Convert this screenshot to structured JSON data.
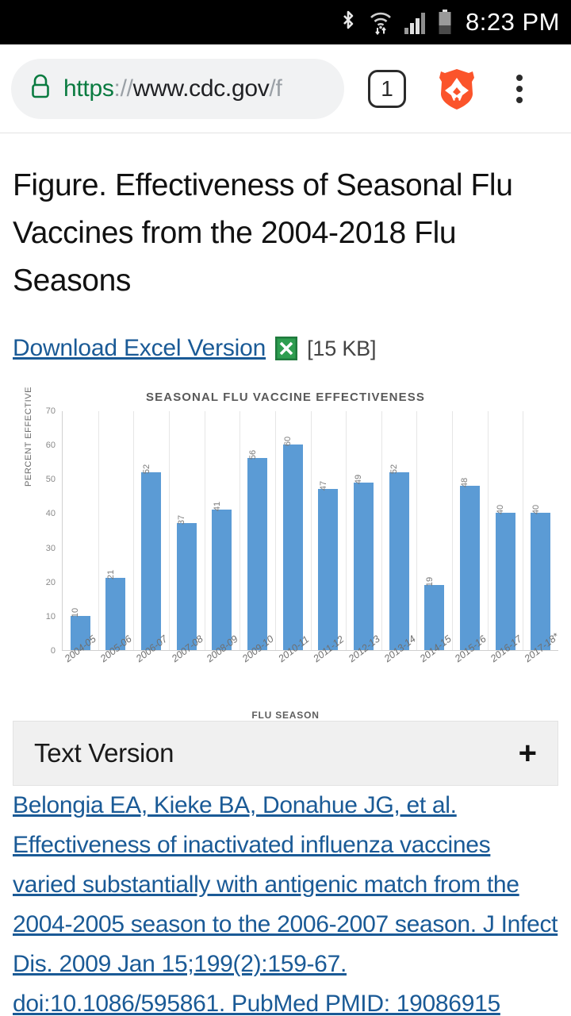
{
  "status_bar": {
    "time": "8:23 PM",
    "icons": [
      "bluetooth-icon",
      "wifi-icon",
      "cell-signal-icon",
      "battery-icon"
    ]
  },
  "browser": {
    "url": {
      "scheme": "https",
      "separator": "://",
      "host": "www.cdc.gov",
      "path": "/f",
      "full": "https://www.cdc.gov/f"
    },
    "lock_icon": "lock-icon",
    "tab_count": "1",
    "brave_icon": "brave-lion-icon",
    "menu_icon": "overflow-menu-icon"
  },
  "page": {
    "title": "Figure. Effectiveness of Seasonal Flu Vaccines from the 2004-2018 Flu Seasons",
    "download_link": "Download Excel Version",
    "excel_icon": "excel-file-icon",
    "file_size": "[15 KB]",
    "accordion": {
      "label": "Text Version",
      "expand_icon": "plus-icon"
    },
    "citation": "Belongia EA, Kieke BA, Donahue JG, et al. Effectiveness of inactivated influenza vaccines varied substantially with antigenic match from the 2004-2005 season to the 2006-2007 season. J Infect Dis. 2009 Jan 15;199(2):159-67. doi:10.1086/595861. PubMed PMID: 19086915"
  },
  "colors": {
    "bar": "#5b9bd5",
    "link": "#1a5a96",
    "brave_orange": "#fb542b",
    "lock_green": "#0a7b40"
  },
  "chart_data": {
    "type": "bar",
    "title": "SEASONAL FLU VACCINE EFFECTIVENESS",
    "xlabel": "FLU SEASON",
    "ylabel": "PERCENT EFFECTIVE",
    "ylim": [
      0,
      70
    ],
    "yticks": [
      0,
      10,
      20,
      30,
      40,
      50,
      60,
      70
    ],
    "grid": "vertical",
    "legend": "none",
    "categories": [
      "2004-05",
      "2005-06",
      "2006-07",
      "2007-08",
      "2008-09",
      "2009-10",
      "2010-11",
      "2011-12",
      "2012-13",
      "2013-14",
      "2014-15",
      "2015-16",
      "2016-17",
      "2017-18*"
    ],
    "values": [
      10,
      21,
      52,
      37,
      41,
      56,
      60,
      47,
      49,
      52,
      19,
      48,
      40,
      40
    ]
  }
}
